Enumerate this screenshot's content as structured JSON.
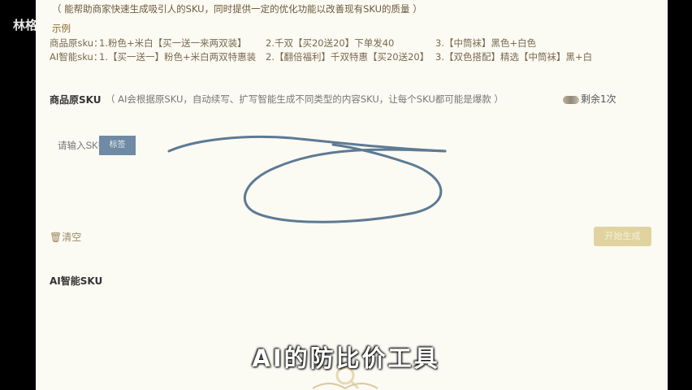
{
  "watermark": "林格",
  "header": {
    "tip": "（ 能帮助商家快速生成吸引人的SKU，同时提供一定的优化功能以改善现有SKU的质量 ）",
    "example_label": "示例"
  },
  "examples": {
    "original": {
      "label": "商品原sku：",
      "items": [
        "1.粉色+米白【买一送一来两双装】",
        "2.千双【买20送20】下单发40",
        "3.【中筒袜】黑色+白色"
      ]
    },
    "ai": {
      "label": "AI智能sku：",
      "items": [
        "1.【买一送一】粉色+米白两双特惠装",
        "2.【翻倍福利】千双特惠【买20送20】",
        "3.【双色搭配】精选【中筒袜】黑+白"
      ]
    }
  },
  "original_sku": {
    "title": "商品原SKU",
    "description": "（ AI会根据原SKU，自动续写、扩写智能生成不同类型的内容SKU，让每个SKU都可能是爆款 ）",
    "remaining": "剩余1次",
    "input_placeholder": "请输入SKU名称，",
    "tag_button": "标签",
    "clear_label": "清空",
    "generate_button": "开始生成"
  },
  "ai_sku": {
    "title": "AI智能SKU"
  },
  "subtitle": "AI的防比价工具",
  "colors": {
    "frame_bg": "#fbfaf3",
    "accent_brown": "#8b6a2f",
    "scribble": "#5d7a93",
    "button_blue": "#6f8aa4",
    "generate_bg": "#e0d39f"
  }
}
